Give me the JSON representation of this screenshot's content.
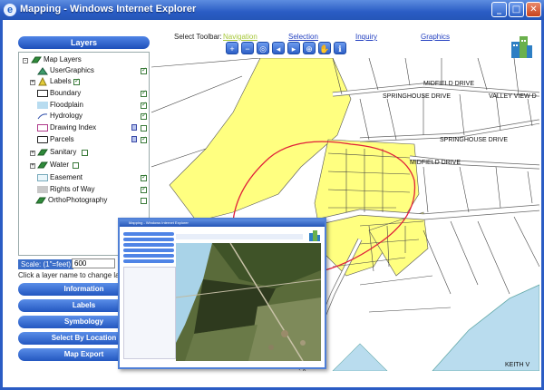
{
  "window": {
    "title": "Mapping - Windows Internet Explorer",
    "controls": [
      "_",
      "□",
      "✕"
    ]
  },
  "layers_panel": {
    "header": "Layers",
    "items": [
      {
        "label": "Map Layers",
        "checked": null
      },
      {
        "label": "UserGraphics",
        "checked": true
      },
      {
        "label": "Labels",
        "checked": true
      },
      {
        "label": "Boundary",
        "checked": true
      },
      {
        "label": "Floodplain",
        "checked": true
      },
      {
        "label": "Hydrology",
        "checked": true
      },
      {
        "label": "Drawing Index",
        "checked": false
      },
      {
        "label": "Parcels",
        "checked": true
      },
      {
        "label": "Sanitary",
        "checked": false
      },
      {
        "label": "Water",
        "checked": false
      },
      {
        "label": "Easement",
        "checked": true
      },
      {
        "label": "Rights of Way",
        "checked": true
      },
      {
        "label": "OrthoPhotography",
        "checked": false
      }
    ],
    "scale_label": "Scale: (1\"=feet)",
    "scale_value": "600",
    "hint": "Click a layer name to change lay"
  },
  "side_buttons": [
    "Information",
    "Labels",
    "Symbology",
    "Select By Location",
    "Map Export"
  ],
  "toolbar": {
    "label": "Select Toolbar:",
    "tabs": [
      "Navigation",
      "Selection",
      "Inquiry",
      "Graphics"
    ],
    "active_tab": "Navigation",
    "tools": [
      "zoom-in",
      "zoom-out",
      "full-extent",
      "previous-extent",
      "next-extent",
      "center",
      "pan",
      "identify"
    ]
  },
  "map": {
    "labels": [
      "MIDFIELD DRIVE",
      "SPRINGHOUSE DRIVE",
      "VALLEY VIEW D",
      "SPRINGHOUSE DRIVE",
      "MIDFIELD DRIVE",
      "KEITH V"
    ],
    "colors": {
      "parcel_highlight": "#ffff80",
      "water": "#b9dcee",
      "buffer": "#e0203a"
    }
  },
  "inset": {
    "title": "Mapping - Windows Internet Explorer"
  }
}
